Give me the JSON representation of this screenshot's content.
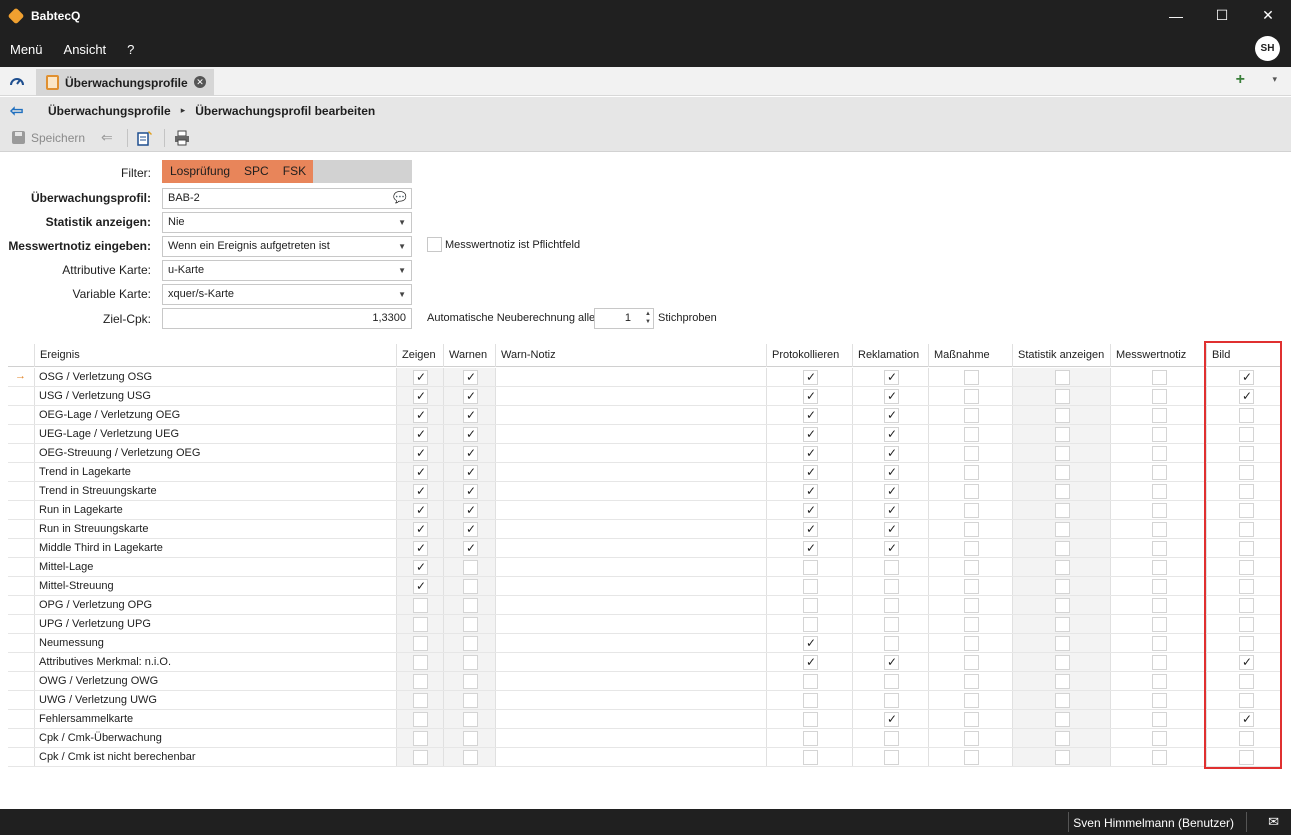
{
  "app": {
    "title": "BabtecQ"
  },
  "window_controls": {
    "minimize": "—",
    "maximize": "☐",
    "close": "✕"
  },
  "menubar": {
    "items": [
      "Menü",
      "Ansicht",
      "?"
    ],
    "avatar": "SH"
  },
  "tabs": {
    "active_label": "Überwachungsprofile",
    "add": "+",
    "menu": "▾"
  },
  "breadcrumb": {
    "items": [
      "Überwachungsprofile",
      "Überwachungsprofil bearbeiten"
    ],
    "separator": "▸"
  },
  "toolbar": {
    "save_label": "Speichern"
  },
  "form": {
    "filter_label": "Filter:",
    "filter_chips": [
      "Losprüfung",
      "SPC",
      "FSK"
    ],
    "profile_label": "Überwachungsprofil:",
    "profile_value": "BAB-2",
    "stats_label": "Statistik anzeigen:",
    "stats_value": "Nie",
    "note_label": "Messwertnotiz eingeben:",
    "note_value": "Wenn ein Ereignis aufgetreten ist",
    "note_required_label": "Messwertnotiz ist Pflichtfeld",
    "attr_label": "Attributive Karte:",
    "attr_value": "u-Karte",
    "var_label": "Variable Karte:",
    "var_value": "xquer/s-Karte",
    "cpk_label": "Ziel-Cpk:",
    "cpk_value": "1,3300",
    "recalc_label": "Automatische Neuberechnung alle",
    "recalc_value": "1",
    "recalc_unit": "Stichproben"
  },
  "grid": {
    "headers": [
      "Ereignis",
      "Zeigen",
      "Warnen",
      "Warn-Notiz",
      "Protokollieren",
      "Reklamation",
      "Maßnahme",
      "Statistik anzeigen",
      "Messwertnotiz",
      "Bild"
    ],
    "rows": [
      {
        "name": "OSG / Verletzung OSG",
        "zeigen": true,
        "warnen": true,
        "protokollieren": true,
        "reklamation": true,
        "massnahme": false,
        "statistik": false,
        "messwertnotiz": false,
        "bild": true
      },
      {
        "name": "USG / Verletzung USG",
        "zeigen": true,
        "warnen": true,
        "protokollieren": true,
        "reklamation": true,
        "massnahme": false,
        "statistik": false,
        "messwertnotiz": false,
        "bild": true
      },
      {
        "name": "OEG-Lage / Verletzung OEG",
        "zeigen": true,
        "warnen": true,
        "protokollieren": true,
        "reklamation": true,
        "massnahme": false,
        "statistik": false,
        "messwertnotiz": false,
        "bild": false
      },
      {
        "name": "UEG-Lage / Verletzung UEG",
        "zeigen": true,
        "warnen": true,
        "protokollieren": true,
        "reklamation": true,
        "massnahme": false,
        "statistik": false,
        "messwertnotiz": false,
        "bild": false
      },
      {
        "name": "OEG-Streuung / Verletzung OEG",
        "zeigen": true,
        "warnen": true,
        "protokollieren": true,
        "reklamation": true,
        "massnahme": false,
        "statistik": false,
        "messwertnotiz": false,
        "bild": false
      },
      {
        "name": "Trend in Lagekarte",
        "zeigen": true,
        "warnen": true,
        "protokollieren": true,
        "reklamation": true,
        "massnahme": false,
        "statistik": false,
        "messwertnotiz": false,
        "bild": false
      },
      {
        "name": "Trend in Streuungskarte",
        "zeigen": true,
        "warnen": true,
        "protokollieren": true,
        "reklamation": true,
        "massnahme": false,
        "statistik": false,
        "messwertnotiz": false,
        "bild": false
      },
      {
        "name": "Run in Lagekarte",
        "zeigen": true,
        "warnen": true,
        "protokollieren": true,
        "reklamation": true,
        "massnahme": false,
        "statistik": false,
        "messwertnotiz": false,
        "bild": false
      },
      {
        "name": "Run in Streuungskarte",
        "zeigen": true,
        "warnen": true,
        "protokollieren": true,
        "reklamation": true,
        "massnahme": false,
        "statistik": false,
        "messwertnotiz": false,
        "bild": false
      },
      {
        "name": "Middle Third in Lagekarte",
        "zeigen": true,
        "warnen": true,
        "protokollieren": true,
        "reklamation": true,
        "massnahme": false,
        "statistik": false,
        "messwertnotiz": false,
        "bild": false
      },
      {
        "name": "Mittel-Lage",
        "zeigen": true,
        "warnen": false,
        "protokollieren": false,
        "reklamation": false,
        "massnahme": false,
        "statistik": false,
        "messwertnotiz": false,
        "bild": false
      },
      {
        "name": "Mittel-Streuung",
        "zeigen": true,
        "warnen": false,
        "protokollieren": false,
        "reklamation": false,
        "massnahme": false,
        "statistik": false,
        "messwertnotiz": false,
        "bild": false
      },
      {
        "name": "OPG / Verletzung OPG",
        "zeigen": false,
        "warnen": false,
        "protokollieren": false,
        "reklamation": false,
        "massnahme": false,
        "statistik": false,
        "messwertnotiz": false,
        "bild": false
      },
      {
        "name": "UPG / Verletzung UPG",
        "zeigen": false,
        "warnen": false,
        "protokollieren": false,
        "reklamation": false,
        "massnahme": false,
        "statistik": false,
        "messwertnotiz": false,
        "bild": false
      },
      {
        "name": "Neumessung",
        "zeigen": false,
        "warnen": false,
        "protokollieren": true,
        "reklamation": false,
        "massnahme": false,
        "statistik": false,
        "messwertnotiz": false,
        "bild": false
      },
      {
        "name": "Attributives Merkmal: n.i.O.",
        "zeigen": false,
        "warnen": false,
        "protokollieren": true,
        "reklamation": true,
        "massnahme": false,
        "statistik": false,
        "messwertnotiz": false,
        "bild": true
      },
      {
        "name": "OWG / Verletzung OWG",
        "zeigen": false,
        "warnen": false,
        "protokollieren": false,
        "reklamation": false,
        "massnahme": false,
        "statistik": false,
        "messwertnotiz": false,
        "bild": false
      },
      {
        "name": "UWG / Verletzung UWG",
        "zeigen": false,
        "warnen": false,
        "protokollieren": false,
        "reklamation": false,
        "massnahme": false,
        "statistik": false,
        "messwertnotiz": false,
        "bild": false
      },
      {
        "name": "Fehlersammelkarte",
        "zeigen": false,
        "warnen": false,
        "protokollieren": false,
        "reklamation": true,
        "massnahme": false,
        "statistik": false,
        "messwertnotiz": false,
        "bild": true
      },
      {
        "name": "Cpk / Cmk-Überwachung",
        "zeigen": false,
        "warnen": false,
        "protokollieren": false,
        "reklamation": false,
        "massnahme": false,
        "statistik": false,
        "messwertnotiz": false,
        "bild": false
      },
      {
        "name": "Cpk / Cmk ist nicht berechenbar",
        "zeigen": false,
        "warnen": false,
        "protokollieren": false,
        "reklamation": false,
        "massnahme": false,
        "statistik": false,
        "messwertnotiz": false,
        "bild": false
      }
    ]
  },
  "status": {
    "user": "Sven Himmelmann (Benutzer)"
  },
  "colors": {
    "accent_filter": "#e8855a",
    "highlight": "#e03030",
    "chrome": "#202020"
  }
}
